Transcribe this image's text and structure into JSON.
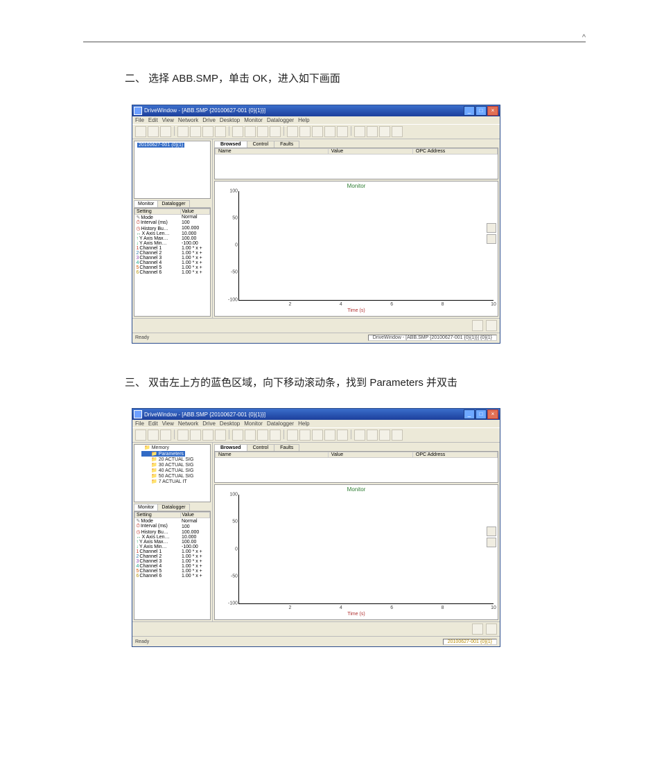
{
  "doc": {
    "caret": "^",
    "step2": "二、 选择 ABB.SMP，单击 OK，进入如下画面",
    "step3": "三、 双击左上方的蓝色区域，向下移动滚动条，找到 Parameters 并双击"
  },
  "app": {
    "title": "DriveWindow - [ABB.SMP {20100627-001 {0}{1}}]",
    "menus": [
      "File",
      "Edit",
      "View",
      "Network",
      "Drive",
      "Desktop",
      "Monitor",
      "Datalogger",
      "Help"
    ],
    "titlebar_buttons": {
      "min": "_",
      "max": "□",
      "close": "×"
    },
    "tree_item1": "20100627-001 {0}{1}",
    "tree2": {
      "memory": "Memory",
      "parameters": "Parameters",
      "children": [
        "20  ACTUAL SIG",
        "30  ACTUAL SIG",
        "40  ACTUAL SIG",
        "50  ACTUAL SIG",
        "7  ACTUAL IT"
      ]
    },
    "mon_tabs": [
      "Monitor",
      "Datalogger"
    ],
    "grid_headers": [
      "Setting",
      "Value"
    ],
    "grid_rows": [
      {
        "k": "Mode",
        "v": "Normal"
      },
      {
        "k": "Interval (ms)",
        "v": "100"
      },
      {
        "k": "History Bu…",
        "v": "100.000"
      },
      {
        "k": "X Axis Len…",
        "v": "10.000"
      },
      {
        "k": "Y Axis Max…",
        "v": "100.00"
      },
      {
        "k": "Y Axis Min…",
        "v": "-100.00"
      },
      {
        "k": "Channel 1",
        "v": "1.00 * x +"
      },
      {
        "k": "Channel 2",
        "v": "1.00 * x +"
      },
      {
        "k": "Channel 3",
        "v": "1.00 * x +"
      },
      {
        "k": "Channel 4",
        "v": "1.00 * x +"
      },
      {
        "k": "Channel 5",
        "v": "1.00 * x +"
      },
      {
        "k": "Channel 6",
        "v": "1.00 * x +"
      }
    ],
    "right_tabs": [
      "Browsed",
      "Control",
      "Faults"
    ],
    "list_headers": [
      "Name",
      "Value",
      "OPC Address"
    ],
    "chart": {
      "title": "Monitor",
      "xlabel": "Time (s)"
    },
    "status_left": "Ready",
    "status_right1": "DriveWindow - [ABB.SMP {20100627-001 {0}{1}}] {0}{1}",
    "status_right2": "20100627-001 {0}{1}"
  },
  "chart_data": {
    "type": "line",
    "title": "Monitor",
    "xlabel": "Time (s)",
    "ylabel": "",
    "xlim": [
      0,
      10
    ],
    "ylim": [
      -100,
      100
    ],
    "x_ticks": [
      2.0,
      4.0,
      6.0,
      8.0,
      10.0
    ],
    "y_ticks": [
      -100,
      -50,
      0,
      50,
      100
    ],
    "series": []
  }
}
